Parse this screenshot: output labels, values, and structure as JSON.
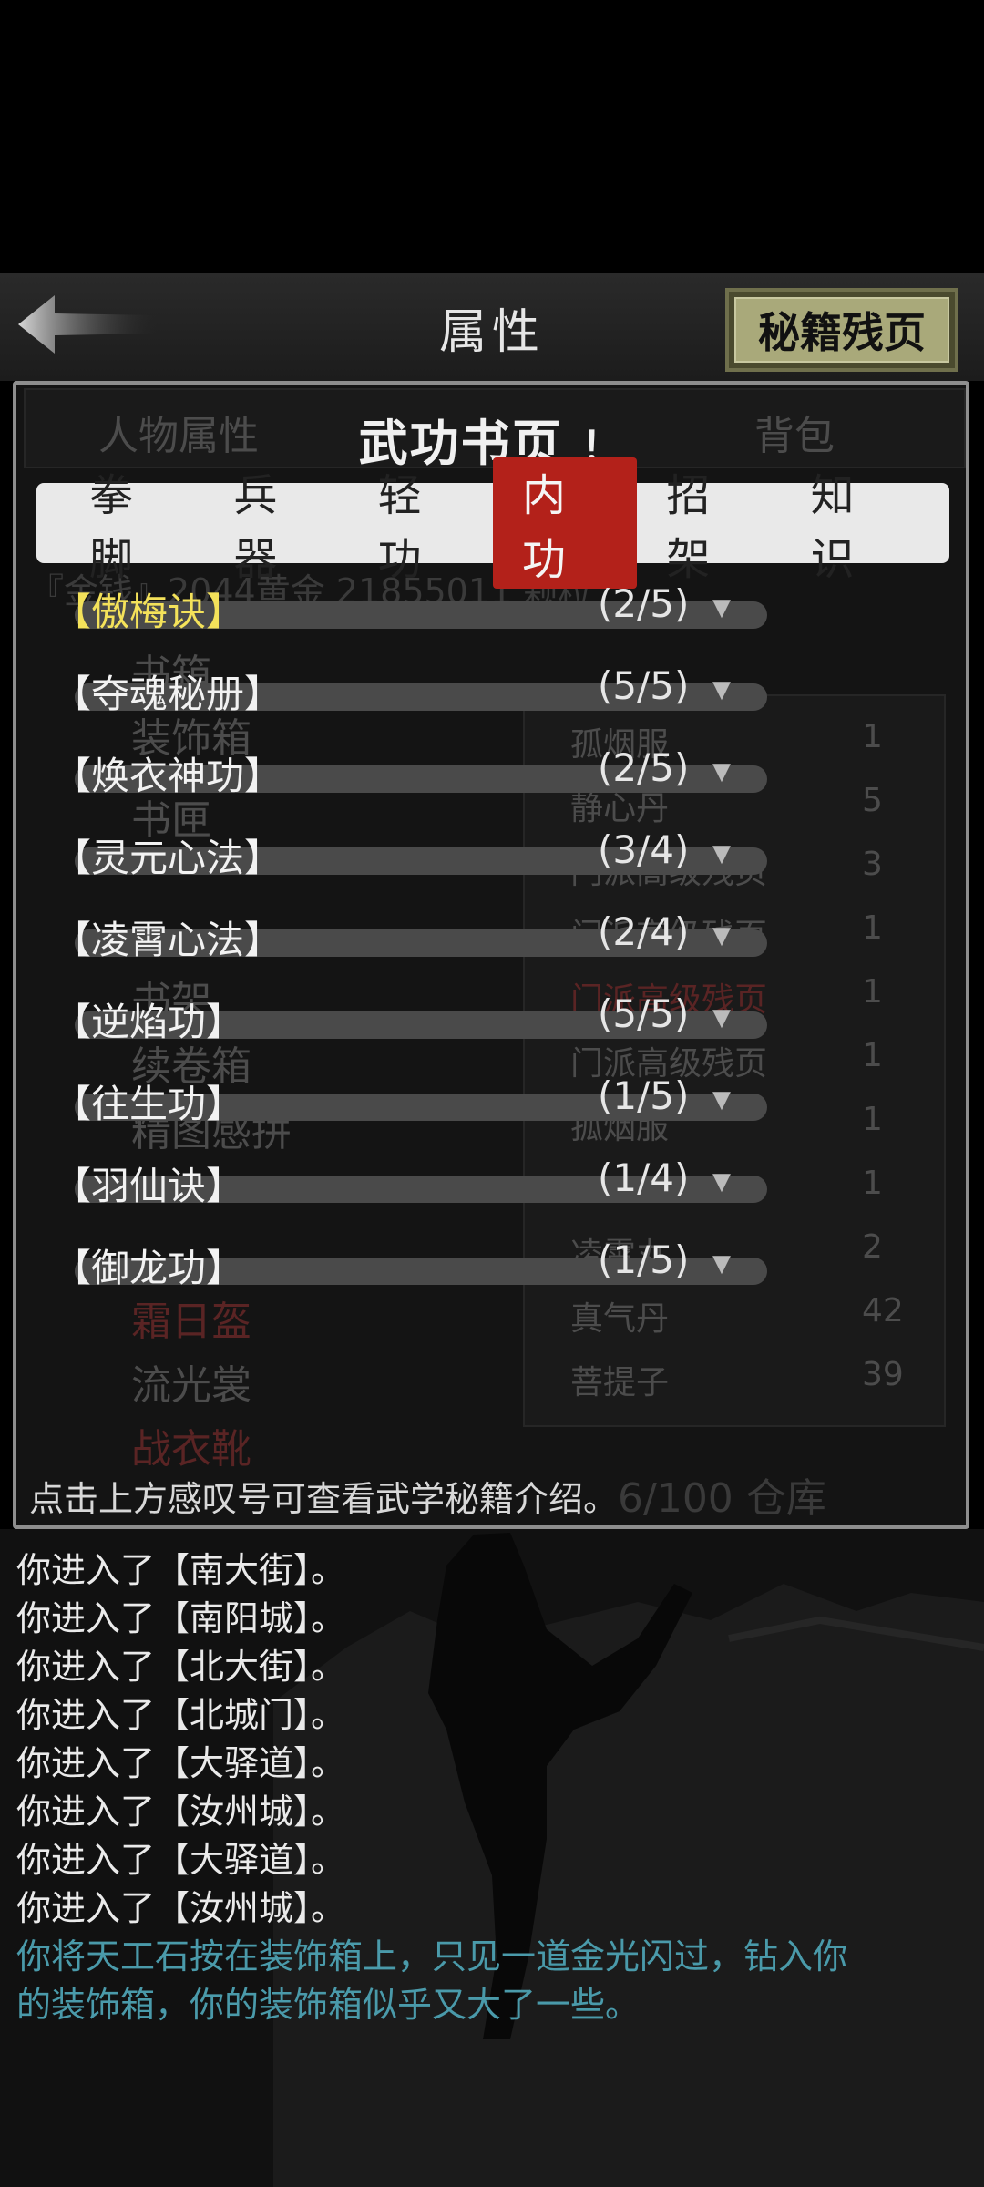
{
  "header": {
    "title": "属性",
    "right_button": "秘籍残页"
  },
  "background_panel": {
    "tabs": [
      "人物属性",
      "背包"
    ],
    "currency_line": "『金钱』2044黄金 21855011 颗粒",
    "categories": [
      "书箱",
      "装饰箱",
      "书匣",
      "书架",
      "续卷箱",
      "精图感拼"
    ],
    "items": [
      {
        "name": "孤烟服",
        "qty": "1"
      },
      {
        "name": "静心丹",
        "qty": "5"
      },
      {
        "name": "门派高级残页",
        "qty": "3"
      },
      {
        "name": "门派高级残页",
        "qty": "1"
      },
      {
        "name": "门派高级残页",
        "qty": "1"
      },
      {
        "name": "门派高级残页",
        "qty": "1"
      },
      {
        "name": "孤烟服",
        "qty": "1"
      },
      {
        "name": "",
        "qty": "1"
      },
      {
        "name": "凌霄丸",
        "qty": "2"
      },
      {
        "name": "真气丹",
        "qty": "42"
      },
      {
        "name": "菩提子",
        "qty": "39"
      }
    ],
    "equip_list": [
      "霜日盔",
      "流光裳",
      "战衣靴"
    ],
    "capacity": "6/100 仓库"
  },
  "dialog": {
    "title": "武功书页",
    "info_mark": "！",
    "tabs": [
      "拳脚",
      "兵器",
      "轻功",
      "内功",
      "招架",
      "知识"
    ],
    "active_tab": "内功",
    "books": [
      {
        "name": "【傲梅诀】",
        "count": "(2/5)",
        "highlight": true
      },
      {
        "name": "【夺魂秘册】",
        "count": "(5/5)",
        "highlight": false
      },
      {
        "name": "【焕衣神功】",
        "count": "(2/5)",
        "highlight": false
      },
      {
        "name": "【灵元心法】",
        "count": "(3/4)",
        "highlight": false
      },
      {
        "name": "【凌霄心法】",
        "count": "(2/4)",
        "highlight": false
      },
      {
        "name": "【逆焰功】",
        "count": "(5/5)",
        "highlight": false
      },
      {
        "name": "【往生功】",
        "count": "(1/5)",
        "highlight": false
      },
      {
        "name": "【羽仙诀】",
        "count": "(1/4)",
        "highlight": false
      },
      {
        "name": "【御龙功】",
        "count": "(1/5)",
        "highlight": false
      }
    ],
    "hint": "点击上方感叹号可查看武学秘籍介绍。"
  },
  "log": [
    "你进入了【南大街】。",
    "你进入了【南阳城】。",
    "你进入了【北大街】。",
    "你进入了【北城门】。",
    "你进入了【大驿道】。",
    "你进入了【汝州城】。",
    "你进入了【大驿道】。",
    "你进入了【汝州城】。"
  ],
  "log_message": [
    "你将天工石按在装饰箱上，只见一道金光闪过，钻入你",
    "的装饰箱，你的装饰箱似乎又大了一些。"
  ],
  "colors": {
    "active_tab": "#b3211a",
    "highlight_text": "#f4e25a",
    "message_text": "#4a9aaa",
    "button_face": "#a9a97a"
  }
}
